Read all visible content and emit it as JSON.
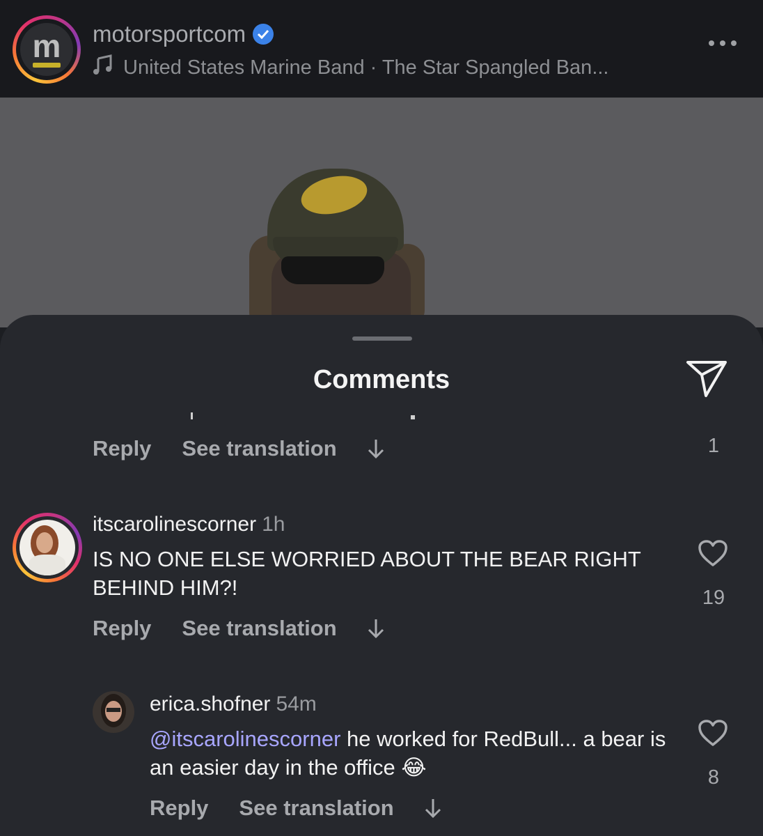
{
  "header": {
    "account_name": "motorsportcom",
    "verified_icon": "verified-badge-icon",
    "music_text": "United States Marine Band · The Star Spangled Ban...",
    "music_icon": "music-note-icon",
    "more_icon": "more-options-icon"
  },
  "sheet": {
    "title": "Comments",
    "share_icon": "send-icon"
  },
  "comments": [
    {
      "reply_label": "Reply",
      "see_translation_label": "See translation",
      "like_count": "1"
    },
    {
      "username": "itscarolinescorner",
      "time": "1h",
      "text": "IS NO ONE ELSE WORRIED ABOUT THE BEAR RIGHT BEHIND HIM?!",
      "reply_label": "Reply",
      "see_translation_label": "See translation",
      "like_count": "19"
    },
    {
      "username": "erica.shofner",
      "time": "54m",
      "mention": "@itscarolinescorner",
      "text_after_mention": " he worked for RedBull... a bear is an easier day in the office 😂",
      "reply_label": "Reply",
      "see_translation_label": "See translation",
      "like_count": "8"
    }
  ],
  "colors": {
    "background": "#26282d",
    "header_bg": "#18191d",
    "mention": "#a8a6ff",
    "muted_text": "#a8aaae"
  }
}
